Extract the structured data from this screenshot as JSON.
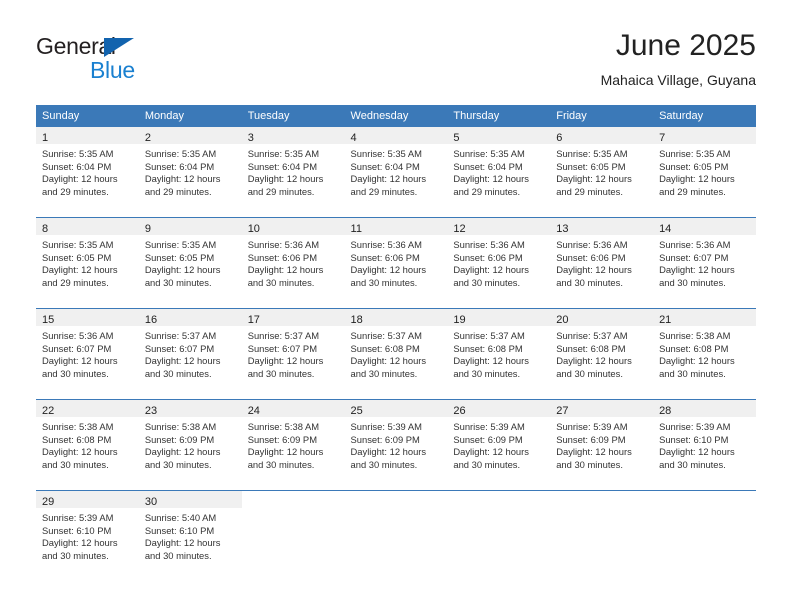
{
  "logo": {
    "word_one": "General",
    "word_two": "Blue",
    "triangle_color": "#1263ae",
    "blue_color": "#1a80d0"
  },
  "header": {
    "title": "June 2025",
    "subtitle": "Mahaica Village, Guyana"
  },
  "theme": {
    "header_blue": "#3b79b8",
    "daynum_band": "#f0f0f0",
    "text": "#222222"
  },
  "weekday_headers": [
    "Sunday",
    "Monday",
    "Tuesday",
    "Wednesday",
    "Thursday",
    "Friday",
    "Saturday"
  ],
  "weeks": [
    [
      {
        "day": "1",
        "sunrise": "Sunrise: 5:35 AM",
        "sunset": "Sunset: 6:04 PM",
        "daylight_1": "Daylight: 12 hours",
        "daylight_2": "and 29 minutes."
      },
      {
        "day": "2",
        "sunrise": "Sunrise: 5:35 AM",
        "sunset": "Sunset: 6:04 PM",
        "daylight_1": "Daylight: 12 hours",
        "daylight_2": "and 29 minutes."
      },
      {
        "day": "3",
        "sunrise": "Sunrise: 5:35 AM",
        "sunset": "Sunset: 6:04 PM",
        "daylight_1": "Daylight: 12 hours",
        "daylight_2": "and 29 minutes."
      },
      {
        "day": "4",
        "sunrise": "Sunrise: 5:35 AM",
        "sunset": "Sunset: 6:04 PM",
        "daylight_1": "Daylight: 12 hours",
        "daylight_2": "and 29 minutes."
      },
      {
        "day": "5",
        "sunrise": "Sunrise: 5:35 AM",
        "sunset": "Sunset: 6:04 PM",
        "daylight_1": "Daylight: 12 hours",
        "daylight_2": "and 29 minutes."
      },
      {
        "day": "6",
        "sunrise": "Sunrise: 5:35 AM",
        "sunset": "Sunset: 6:05 PM",
        "daylight_1": "Daylight: 12 hours",
        "daylight_2": "and 29 minutes."
      },
      {
        "day": "7",
        "sunrise": "Sunrise: 5:35 AM",
        "sunset": "Sunset: 6:05 PM",
        "daylight_1": "Daylight: 12 hours",
        "daylight_2": "and 29 minutes."
      }
    ],
    [
      {
        "day": "8",
        "sunrise": "Sunrise: 5:35 AM",
        "sunset": "Sunset: 6:05 PM",
        "daylight_1": "Daylight: 12 hours",
        "daylight_2": "and 29 minutes."
      },
      {
        "day": "9",
        "sunrise": "Sunrise: 5:35 AM",
        "sunset": "Sunset: 6:05 PM",
        "daylight_1": "Daylight: 12 hours",
        "daylight_2": "and 30 minutes."
      },
      {
        "day": "10",
        "sunrise": "Sunrise: 5:36 AM",
        "sunset": "Sunset: 6:06 PM",
        "daylight_1": "Daylight: 12 hours",
        "daylight_2": "and 30 minutes."
      },
      {
        "day": "11",
        "sunrise": "Sunrise: 5:36 AM",
        "sunset": "Sunset: 6:06 PM",
        "daylight_1": "Daylight: 12 hours",
        "daylight_2": "and 30 minutes."
      },
      {
        "day": "12",
        "sunrise": "Sunrise: 5:36 AM",
        "sunset": "Sunset: 6:06 PM",
        "daylight_1": "Daylight: 12 hours",
        "daylight_2": "and 30 minutes."
      },
      {
        "day": "13",
        "sunrise": "Sunrise: 5:36 AM",
        "sunset": "Sunset: 6:06 PM",
        "daylight_1": "Daylight: 12 hours",
        "daylight_2": "and 30 minutes."
      },
      {
        "day": "14",
        "sunrise": "Sunrise: 5:36 AM",
        "sunset": "Sunset: 6:07 PM",
        "daylight_1": "Daylight: 12 hours",
        "daylight_2": "and 30 minutes."
      }
    ],
    [
      {
        "day": "15",
        "sunrise": "Sunrise: 5:36 AM",
        "sunset": "Sunset: 6:07 PM",
        "daylight_1": "Daylight: 12 hours",
        "daylight_2": "and 30 minutes."
      },
      {
        "day": "16",
        "sunrise": "Sunrise: 5:37 AM",
        "sunset": "Sunset: 6:07 PM",
        "daylight_1": "Daylight: 12 hours",
        "daylight_2": "and 30 minutes."
      },
      {
        "day": "17",
        "sunrise": "Sunrise: 5:37 AM",
        "sunset": "Sunset: 6:07 PM",
        "daylight_1": "Daylight: 12 hours",
        "daylight_2": "and 30 minutes."
      },
      {
        "day": "18",
        "sunrise": "Sunrise: 5:37 AM",
        "sunset": "Sunset: 6:08 PM",
        "daylight_1": "Daylight: 12 hours",
        "daylight_2": "and 30 minutes."
      },
      {
        "day": "19",
        "sunrise": "Sunrise: 5:37 AM",
        "sunset": "Sunset: 6:08 PM",
        "daylight_1": "Daylight: 12 hours",
        "daylight_2": "and 30 minutes."
      },
      {
        "day": "20",
        "sunrise": "Sunrise: 5:37 AM",
        "sunset": "Sunset: 6:08 PM",
        "daylight_1": "Daylight: 12 hours",
        "daylight_2": "and 30 minutes."
      },
      {
        "day": "21",
        "sunrise": "Sunrise: 5:38 AM",
        "sunset": "Sunset: 6:08 PM",
        "daylight_1": "Daylight: 12 hours",
        "daylight_2": "and 30 minutes."
      }
    ],
    [
      {
        "day": "22",
        "sunrise": "Sunrise: 5:38 AM",
        "sunset": "Sunset: 6:08 PM",
        "daylight_1": "Daylight: 12 hours",
        "daylight_2": "and 30 minutes."
      },
      {
        "day": "23",
        "sunrise": "Sunrise: 5:38 AM",
        "sunset": "Sunset: 6:09 PM",
        "daylight_1": "Daylight: 12 hours",
        "daylight_2": "and 30 minutes."
      },
      {
        "day": "24",
        "sunrise": "Sunrise: 5:38 AM",
        "sunset": "Sunset: 6:09 PM",
        "daylight_1": "Daylight: 12 hours",
        "daylight_2": "and 30 minutes."
      },
      {
        "day": "25",
        "sunrise": "Sunrise: 5:39 AM",
        "sunset": "Sunset: 6:09 PM",
        "daylight_1": "Daylight: 12 hours",
        "daylight_2": "and 30 minutes."
      },
      {
        "day": "26",
        "sunrise": "Sunrise: 5:39 AM",
        "sunset": "Sunset: 6:09 PM",
        "daylight_1": "Daylight: 12 hours",
        "daylight_2": "and 30 minutes."
      },
      {
        "day": "27",
        "sunrise": "Sunrise: 5:39 AM",
        "sunset": "Sunset: 6:09 PM",
        "daylight_1": "Daylight: 12 hours",
        "daylight_2": "and 30 minutes."
      },
      {
        "day": "28",
        "sunrise": "Sunrise: 5:39 AM",
        "sunset": "Sunset: 6:10 PM",
        "daylight_1": "Daylight: 12 hours",
        "daylight_2": "and 30 minutes."
      }
    ],
    [
      {
        "day": "29",
        "sunrise": "Sunrise: 5:39 AM",
        "sunset": "Sunset: 6:10 PM",
        "daylight_1": "Daylight: 12 hours",
        "daylight_2": "and 30 minutes."
      },
      {
        "day": "30",
        "sunrise": "Sunrise: 5:40 AM",
        "sunset": "Sunset: 6:10 PM",
        "daylight_1": "Daylight: 12 hours",
        "daylight_2": "and 30 minutes."
      },
      {
        "day": "",
        "sunrise": "",
        "sunset": "",
        "daylight_1": "",
        "daylight_2": ""
      },
      {
        "day": "",
        "sunrise": "",
        "sunset": "",
        "daylight_1": "",
        "daylight_2": ""
      },
      {
        "day": "",
        "sunrise": "",
        "sunset": "",
        "daylight_1": "",
        "daylight_2": ""
      },
      {
        "day": "",
        "sunrise": "",
        "sunset": "",
        "daylight_1": "",
        "daylight_2": ""
      },
      {
        "day": "",
        "sunrise": "",
        "sunset": "",
        "daylight_1": "",
        "daylight_2": ""
      }
    ]
  ]
}
